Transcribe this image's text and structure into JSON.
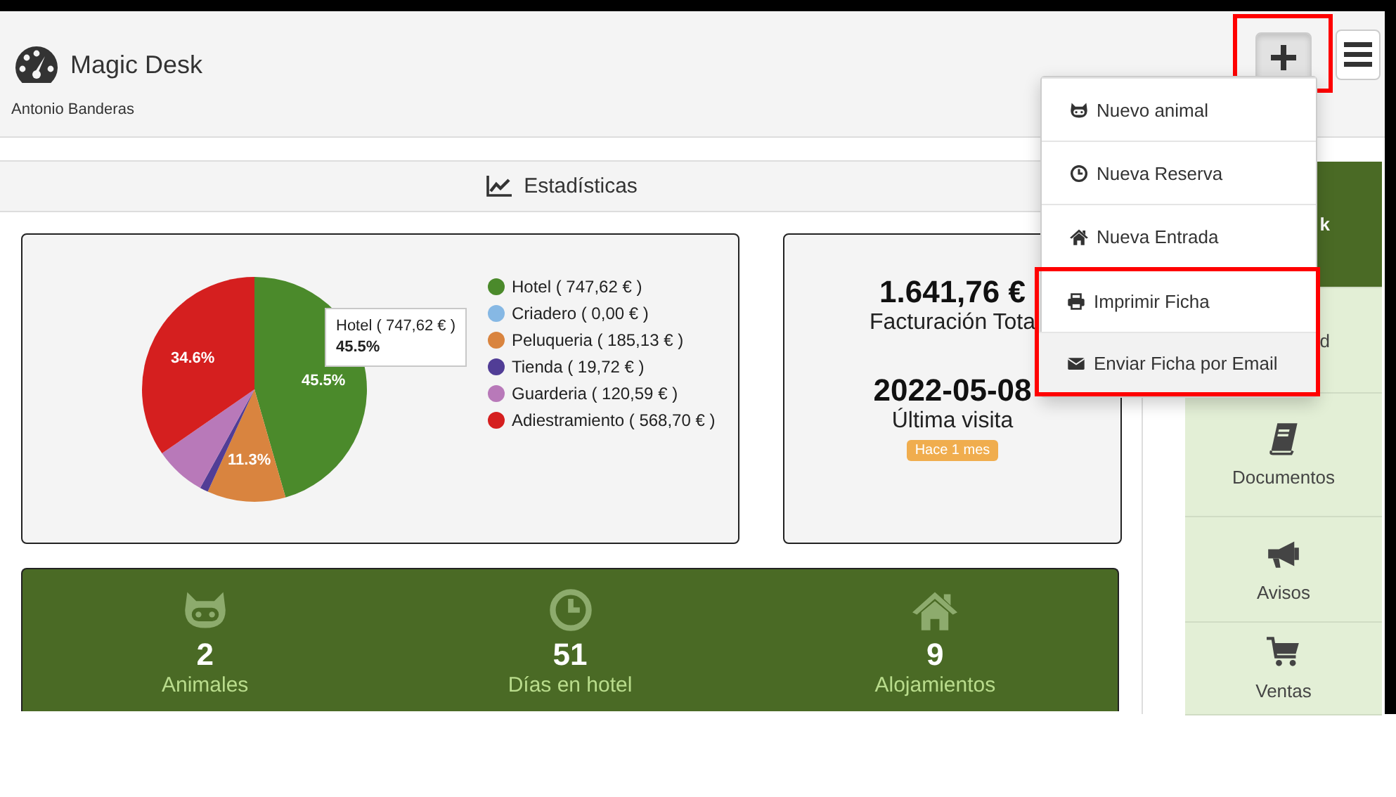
{
  "header": {
    "title": "Magic Desk",
    "user": "Antonio Banderas"
  },
  "toolbar": {
    "buttons": [
      {
        "kind": "add",
        "active": true,
        "highlighted": true
      },
      {
        "kind": "menu",
        "active": false,
        "highlighted": false
      }
    ]
  },
  "add_menu": {
    "items": [
      {
        "kind": "animal",
        "label": "Nuevo animal",
        "hovered": false,
        "highlighted": false
      },
      {
        "kind": "booking",
        "label": "Nueva Reserva",
        "hovered": false,
        "highlighted": false
      },
      {
        "kind": "entry",
        "label": "Nueva Entrada",
        "hovered": false,
        "highlighted": false
      },
      {
        "kind": "print",
        "label": "Imprimir Ficha",
        "hovered": false,
        "highlighted": true
      },
      {
        "kind": "email",
        "label": "Enviar Ficha por Email",
        "hovered": true,
        "highlighted": true
      }
    ]
  },
  "section_title": "Estadísticas",
  "chart_data": {
    "type": "pie",
    "categories": [
      "Hotel ( 747,62 € )",
      "Criadero ( 0,00 € )",
      "Peluqueria ( 185,13 € )",
      "Tienda ( 19,72 € )",
      "Guarderia ( 120,59 € )",
      "Adiestramiento ( 568,70 € )"
    ],
    "colors": [
      "#4b8a2b",
      "#86b8e4",
      "#d9843f",
      "#513d96",
      "#b879b9",
      "#d51f1f"
    ],
    "series": [
      {
        "values": [
          747.62,
          0,
          185.13,
          19.72,
          120.59,
          568.7
        ]
      }
    ],
    "legend": true,
    "value_labels": [
      "45.5%",
      null,
      "11.3%",
      null,
      null,
      "34.6%"
    ],
    "annotations": [
      {
        "text": "Hotel ( 747,62 € )"
      },
      {
        "text": "45.5%"
      }
    ]
  },
  "summary": {
    "total": "1.641,76 €",
    "total_label": "Facturación Tota",
    "last_visit": "2022-05-08",
    "last_visit_label": "Última visita",
    "badge": "Hace 1 mes"
  },
  "counters": [
    {
      "kind": "animals",
      "value": "2",
      "label": "Animales"
    },
    {
      "kind": "hotel",
      "value": "51",
      "label": "Días en hotel"
    },
    {
      "kind": "lodging",
      "value": "9",
      "label": "Alojamientos"
    }
  ],
  "sidebar": {
    "items": [
      {
        "kind": "desk",
        "label": "k",
        "selected": true,
        "partly_hidden": true
      },
      {
        "kind": "other",
        "label": "d",
        "selected": false,
        "partly_hidden": true
      },
      {
        "kind": "documents",
        "label": "Documentos",
        "selected": false,
        "partly_hidden": false
      },
      {
        "kind": "notices",
        "label": "Avisos",
        "selected": false,
        "partly_hidden": false
      },
      {
        "kind": "sales",
        "label": "Ventas",
        "selected": false,
        "partly_hidden": false
      }
    ]
  }
}
